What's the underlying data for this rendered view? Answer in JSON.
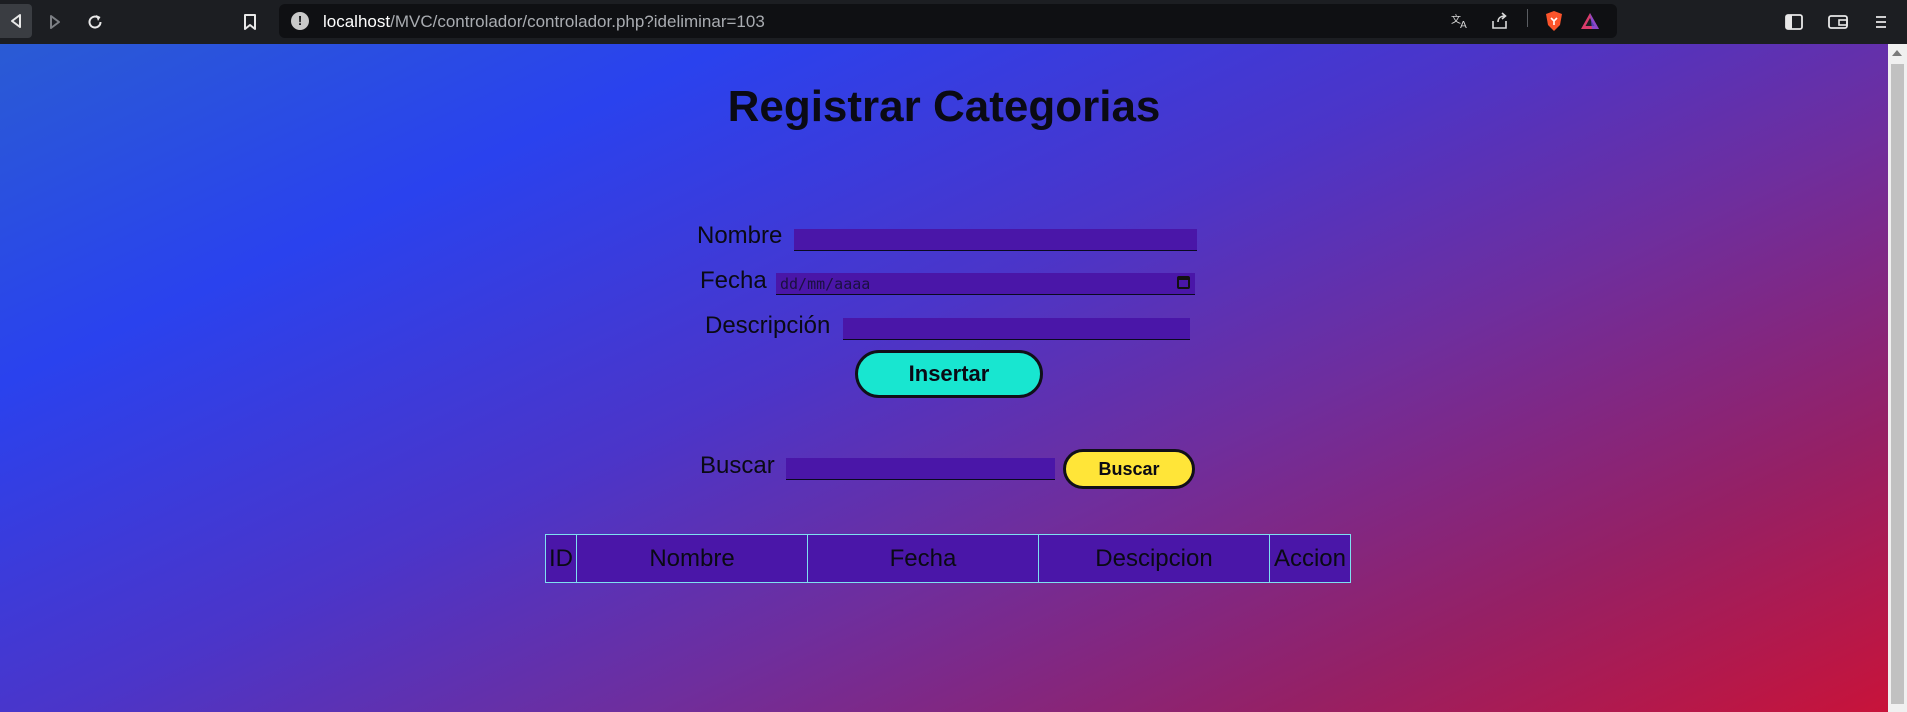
{
  "browser": {
    "url_host": "localhost",
    "url_path": "/MVC/controlador/controlador.php?ideliminar=103"
  },
  "page": {
    "title": "Registrar Categorias",
    "form": {
      "nombre_label": "Nombre",
      "nombre_value": "",
      "fecha_label": "Fecha",
      "fecha_placeholder": "dd/mm/aaaa",
      "descripcion_label": "Descripción",
      "descripcion_value": "",
      "insertar_label": "Insertar"
    },
    "search": {
      "label": "Buscar",
      "value": "",
      "button_label": "Buscar"
    },
    "table": {
      "headers": [
        "ID",
        "Nombre",
        "Fecha",
        "Descipcion",
        "Accion"
      ]
    }
  },
  "colors": {
    "input_bg": "#4a16a8",
    "insert_button": "#18e6d0",
    "search_button": "#ffe538",
    "table_border": "#7ee0f0"
  },
  "icons": [
    "back-icon",
    "forward-icon",
    "reload-icon",
    "bookmark-icon",
    "site-info-icon",
    "translate-icon",
    "share-icon",
    "brave-shield-icon",
    "brave-rewards-icon",
    "sidebar-icon",
    "wallet-icon",
    "menu-icon",
    "calendar-icon"
  ]
}
